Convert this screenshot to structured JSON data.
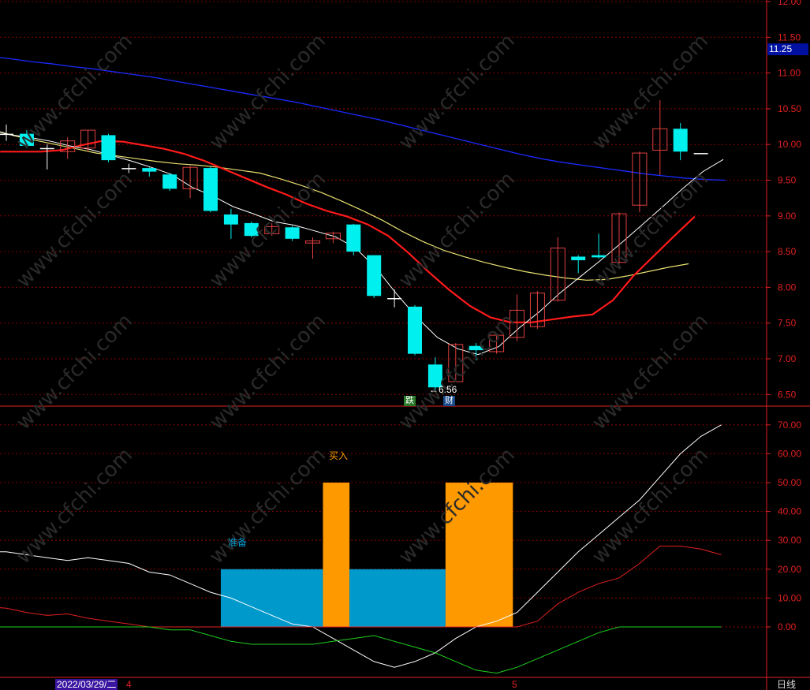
{
  "colors": {
    "background": "#000000",
    "up": "#e04040",
    "down": "#00f0f0",
    "ma5": "#ffffff",
    "ma10": "#ff1a1a",
    "ma20": "#e8e070",
    "ma60": "#1a2aff",
    "grid": "#8a0000",
    "axis_text": "#e02020",
    "prepare_bar": "#0099cc",
    "buy_bar": "#ff9900",
    "osc_white": "#ffffff",
    "osc_red": "#e02020",
    "osc_green": "#20d020"
  },
  "header": {
    "last_price": "11.25",
    "date_label": "2022/03/29/二",
    "month_labels": [
      "4",
      "5"
    ],
    "period": "日线"
  },
  "markers": {
    "low_label": "6.56",
    "badge_die": "跌",
    "badge_cai": "财"
  },
  "chart_data": [
    {
      "type": "candlestick",
      "title": "",
      "ylim": [
        6.3,
        12.05
      ],
      "ytick_labels": [
        "12.00",
        "11.50",
        "11.00",
        "10.50",
        "10.00",
        "9.50",
        "9.00",
        "8.50",
        "8.00",
        "7.50",
        "7.00",
        "6.50"
      ],
      "candles": [
        {
          "open": 10.15,
          "close": 10.15,
          "high": 10.28,
          "low": 10.05
        },
        {
          "open": 10.15,
          "close": 9.98,
          "high": 10.2,
          "low": 9.95
        },
        {
          "open": 9.95,
          "close": 9.95,
          "high": 10.0,
          "low": 9.65
        },
        {
          "open": 9.9,
          "close": 10.05,
          "high": 10.1,
          "low": 9.8
        },
        {
          "open": 9.95,
          "close": 10.2,
          "high": 10.2,
          "low": 9.9
        },
        {
          "open": 10.13,
          "close": 9.78,
          "high": 10.15,
          "low": 9.75
        },
        {
          "open": 9.67,
          "close": 9.67,
          "high": 9.73,
          "low": 9.6
        },
        {
          "open": 9.67,
          "close": 9.62,
          "high": 9.68,
          "low": 9.55
        },
        {
          "open": 9.58,
          "close": 9.38,
          "high": 9.6,
          "low": 9.35
        },
        {
          "open": 9.38,
          "close": 9.68,
          "high": 9.7,
          "low": 9.25
        },
        {
          "open": 9.67,
          "close": 9.07,
          "high": 9.7,
          "low": 9.05
        },
        {
          "open": 9.02,
          "close": 8.88,
          "high": 9.1,
          "low": 8.68
        },
        {
          "open": 8.9,
          "close": 8.72,
          "high": 8.92,
          "low": 8.7
        },
        {
          "open": 8.75,
          "close": 8.85,
          "high": 8.9,
          "low": 8.72
        },
        {
          "open": 8.84,
          "close": 8.68,
          "high": 8.86,
          "low": 8.65
        },
        {
          "open": 8.62,
          "close": 8.65,
          "high": 8.7,
          "low": 8.4
        },
        {
          "open": 8.68,
          "close": 8.76,
          "high": 8.78,
          "low": 8.62
        },
        {
          "open": 8.88,
          "close": 8.5,
          "high": 8.89,
          "low": 8.45
        },
        {
          "open": 8.45,
          "close": 7.88,
          "high": 8.45,
          "low": 7.85
        },
        {
          "open": 7.85,
          "close": 7.85,
          "high": 7.97,
          "low": 7.72
        },
        {
          "open": 7.73,
          "close": 7.07,
          "high": 7.75,
          "low": 7.05
        },
        {
          "open": 6.92,
          "close": 6.6,
          "high": 7.02,
          "low": 6.56
        },
        {
          "open": 6.68,
          "close": 7.2,
          "high": 7.22,
          "low": 6.68
        },
        {
          "open": 7.18,
          "close": 7.12,
          "high": 7.22,
          "low": 6.98
        },
        {
          "open": 7.1,
          "close": 7.33,
          "high": 7.35,
          "low": 7.07
        },
        {
          "open": 7.3,
          "close": 7.68,
          "high": 7.9,
          "low": 7.25
        },
        {
          "open": 7.45,
          "close": 7.92,
          "high": 7.95,
          "low": 7.42
        },
        {
          "open": 7.82,
          "close": 8.55,
          "high": 8.7,
          "low": 7.8
        },
        {
          "open": 8.43,
          "close": 8.38,
          "high": 8.45,
          "low": 8.2
        },
        {
          "open": 8.45,
          "close": 8.42,
          "high": 8.75,
          "low": 8.4
        },
        {
          "open": 8.35,
          "close": 9.03,
          "high": 9.05,
          "low": 8.33
        },
        {
          "open": 9.15,
          "close": 9.88,
          "high": 9.9,
          "low": 9.05
        },
        {
          "open": 9.92,
          "close": 10.22,
          "high": 10.62,
          "low": 9.57
        },
        {
          "open": 10.22,
          "close": 9.9,
          "high": 10.3,
          "low": 9.78
        },
        {
          "open": 9.88,
          "close": 9.88,
          "high": 9.88,
          "low": 9.88
        }
      ],
      "series": [
        {
          "name": "MA5",
          "values": [
            10.22,
            10.14,
            10.1,
            10.05,
            9.98,
            9.93,
            9.85,
            9.77,
            9.68,
            9.58,
            9.4,
            9.28,
            9.13,
            9.03,
            8.92,
            8.87,
            8.79,
            8.71,
            8.55,
            8.27,
            7.91,
            7.58,
            7.3,
            7.14,
            7.06,
            7.17,
            7.43,
            7.66,
            7.92,
            8.15,
            8.38,
            8.62,
            8.87,
            9.12,
            9.38,
            9.62,
            9.79
          ]
        },
        {
          "name": "MA10",
          "values": [
            9.9,
            9.9,
            9.9,
            9.92,
            9.99,
            10.05,
            10.04,
            9.99,
            9.94,
            9.87,
            9.77,
            9.65,
            9.53,
            9.41,
            9.3,
            9.17,
            9.07,
            8.99,
            8.88,
            8.72,
            8.48,
            8.21,
            7.96,
            7.74,
            7.58,
            7.51,
            7.51,
            7.55,
            7.59,
            7.62,
            7.82,
            8.16,
            8.44,
            8.72,
            8.99
          ]
        },
        {
          "name": "MA20",
          "values": [
            10.2,
            10.12,
            10.06,
            10.0,
            9.94,
            9.88,
            9.84,
            9.8,
            9.76,
            9.73,
            9.71,
            9.68,
            9.64,
            9.6,
            9.52,
            9.43,
            9.33,
            9.21,
            9.08,
            8.94,
            8.78,
            8.64,
            8.52,
            8.43,
            8.35,
            8.28,
            8.22,
            8.17,
            8.13,
            8.1,
            8.11,
            8.16,
            8.22,
            8.28,
            8.33
          ]
        },
        {
          "name": "MA60",
          "values": [
            11.23,
            11.2,
            11.16,
            11.13,
            11.09,
            11.06,
            11.02,
            10.98,
            10.94,
            10.89,
            10.84,
            10.79,
            10.74,
            10.69,
            10.64,
            10.59,
            10.53,
            10.47,
            10.41,
            10.35,
            10.28,
            10.21,
            10.14,
            10.07,
            10.0,
            9.93,
            9.86,
            9.8,
            9.75,
            9.71,
            9.67,
            9.63,
            9.59,
            9.56,
            9.53,
            9.51,
            9.5
          ]
        }
      ]
    },
    {
      "type": "bar",
      "title": "",
      "ylim": [
        -7,
        72
      ],
      "ytick_labels": [
        "70.00",
        "60.00",
        "50.00",
        "40.00",
        "30.00",
        "20.00",
        "10.00",
        "0.00"
      ],
      "signal_labels": {
        "buy": "买入",
        "prepare": "准备"
      },
      "bars": [
        {
          "signal": "prepare",
          "from": 10.5,
          "to": 15.5,
          "value": 20
        },
        {
          "signal": "buy",
          "from": 15.5,
          "to": 16.8,
          "value": 50
        },
        {
          "signal": "prepare",
          "from": 16.8,
          "to": 21.5,
          "value": 20
        },
        {
          "signal": "buy",
          "from": 21.5,
          "to": 24.8,
          "value": 50
        }
      ],
      "series": [
        {
          "name": "",
          "values": [
            26,
            26,
            25,
            24,
            23,
            24,
            23,
            22,
            19,
            18,
            15,
            12,
            10,
            7,
            4,
            1,
            0,
            -4,
            -8,
            -12,
            -14,
            -12,
            -9,
            -4,
            0,
            2,
            5,
            12,
            19,
            26,
            32,
            38,
            44,
            52,
            60,
            66,
            70
          ]
        },
        {
          "name": "",
          "values": [
            7,
            6.5,
            5,
            4,
            4.5,
            3,
            2,
            1,
            0,
            0,
            0,
            0,
            0,
            0,
            0,
            0,
            0,
            0,
            0,
            0,
            0,
            0,
            0,
            0,
            0,
            0,
            0,
            2,
            8,
            12,
            15,
            17,
            22,
            28,
            28,
            27,
            25
          ]
        },
        {
          "name": "",
          "values": [
            0,
            0,
            0,
            0,
            0,
            0,
            0,
            0,
            0,
            -1,
            -1,
            -3,
            -5,
            -6,
            -6,
            -6,
            -6,
            -5,
            -4,
            -3,
            -5,
            -7,
            -9,
            -12,
            -15,
            -16,
            -14,
            -11,
            -8,
            -5,
            -2,
            0,
            0,
            0,
            0,
            0,
            0
          ]
        }
      ]
    }
  ]
}
